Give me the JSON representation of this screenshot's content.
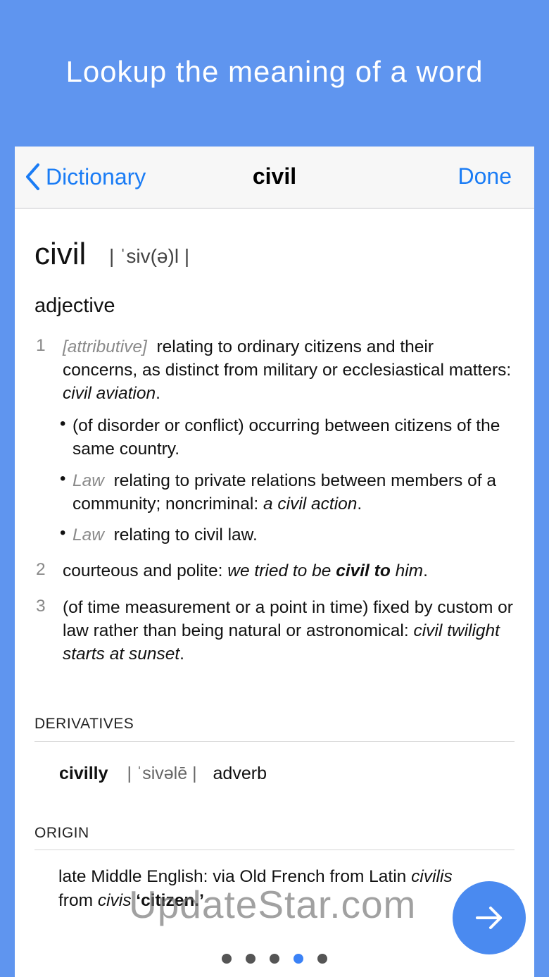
{
  "headline": "Lookup the meaning of a word",
  "nav": {
    "back_label": "Dictionary",
    "title": "civil",
    "done_label": "Done"
  },
  "entry": {
    "word": "civil",
    "pronunciation": "| ˈsiv(ə)l |",
    "part_of_speech": "adjective",
    "senses": [
      {
        "number": "1",
        "label": "[attributive]",
        "text": "relating to ordinary citizens and their concerns, as distinct from military or ecclesiastical matters:",
        "example": "civil aviation"
      },
      {
        "number": "2",
        "text": "courteous and polite:",
        "example_pre": "we tried to be",
        "example_bold": "civil to",
        "example_post": "him"
      },
      {
        "number": "3",
        "text": "(of time measurement or a point in time) fixed by custom or law rather than being natural or astronomical:",
        "example": "civil twilight starts at sunset"
      }
    ],
    "subsenses": [
      {
        "bullet": "•",
        "text": "(of disorder or conflict) occurring between citizens of the same country."
      },
      {
        "bullet": "•",
        "label": "Law",
        "text": "relating to private relations between members of a community; noncriminal:",
        "example": "a civil action"
      },
      {
        "bullet": "•",
        "label": "Law",
        "text": "relating to civil law."
      }
    ]
  },
  "derivatives": {
    "title": "DERIVATIVES",
    "word": "civilly",
    "pronunciation": "| ˈsivəlē |",
    "pos": "adverb"
  },
  "origin": {
    "title": "ORIGIN",
    "text_1": "late Middle English: via Old French from Latin",
    "latin_1": "civilis",
    "text_2": "from",
    "latin_2": "civis",
    "gloss": "‘citizen.’"
  },
  "pager": {
    "count": 5,
    "active_index": 3
  },
  "watermark": "UpdateStar.com",
  "colors": {
    "background": "#5f95ef",
    "accent": "#1a7cf5",
    "button": "#4a8af0"
  },
  "icons": {
    "back": "chevron-left-icon",
    "next": "arrow-right-icon"
  }
}
